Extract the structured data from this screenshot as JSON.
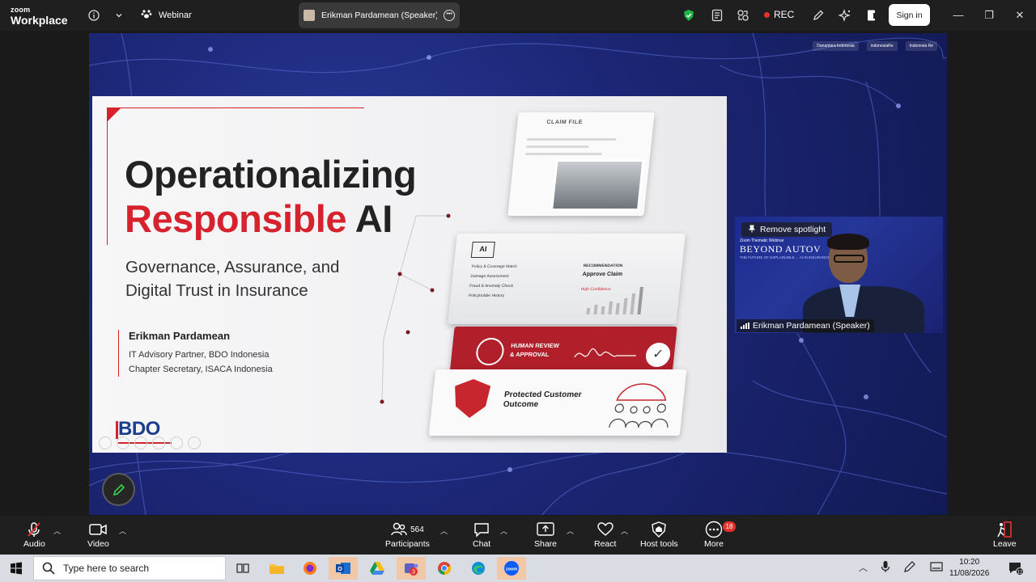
{
  "app": {
    "brand_top": "zoom",
    "brand_bottom": "Workplace"
  },
  "topbar": {
    "webinar_label": "Webinar",
    "speaker_tab": "Erikman Pardamean (Speaker)'s sc",
    "rec_label": "REC",
    "signin_label": "Sign in",
    "win_min": "—",
    "win_restore": "❐",
    "win_close": "✕"
  },
  "slide": {
    "title_line1": "Operationalizing",
    "title_line2_red": "Responsible",
    "title_line2_rest": " AI",
    "subtitle_line1": "Governance, Assurance, and",
    "subtitle_line2": "Digital Trust in Insurance",
    "presenter_name": "Erikman Pardamean",
    "presenter_role1": "IT Advisory Partner, BDO Indonesia",
    "presenter_role2": "Chapter Secretary, ISACA Indonesia",
    "logo": "BDO",
    "claim_file": "CLAIM FILE",
    "ai_label": "AI",
    "checks": [
      "Policy & Coverage Match",
      "Damage Assessment",
      "Fraud & Anomaly Check",
      "Policyholder History"
    ],
    "recommendation_head": "RECOMMENDATION",
    "recommendation_value": "Approve Claim",
    "confidence": "High Confidence",
    "human_review": "HUMAN REVIEW",
    "approval": "& APPROVAL",
    "protected_line1": "Protected Customer",
    "protected_line2": "Outcome"
  },
  "stage_logos": [
    "Danantara Indonesia",
    "indonesiaRe",
    "Indonesia Re"
  ],
  "speaker_video": {
    "spotlight_label": "Remove spotlight",
    "webinar_sub": "Zoom Thematic Webinar",
    "webinar_title": "BEYOND AUTOV",
    "webinar_tag": "THE FUTURE OF EXPLAINABLE ... AI IN INSURANCE",
    "name": "Erikman Pardamean (Speaker)"
  },
  "bottombar": {
    "audio": "Audio",
    "video": "Video",
    "participants": "Participants",
    "participants_count": "564",
    "chat": "Chat",
    "share": "Share",
    "react": "React",
    "host_tools": "Host tools",
    "more": "More",
    "more_badge": "18",
    "leave": "Leave"
  },
  "taskbar": {
    "search_placeholder": "Type here to search",
    "teams_badge": "3",
    "time": "10:20",
    "date": "11/08/2026",
    "notif_count": "12"
  },
  "colors": {
    "accent_red": "#d6222c",
    "stage_blue": "#1c2675",
    "rec_red": "#e5322d",
    "shield_green": "#1fb34a"
  }
}
